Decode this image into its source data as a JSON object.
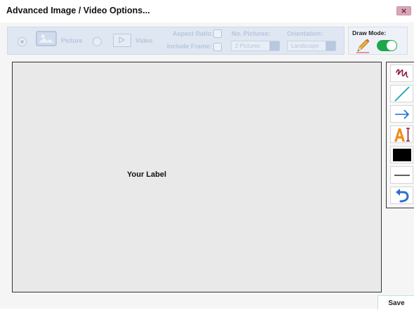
{
  "dialog": {
    "title": "Advanced Image / Video Options...",
    "close_icon": "close-x-icon"
  },
  "options": {
    "picture_label": "Picture",
    "video_label": "Video",
    "picture_selected": true,
    "aspect_ratio_label": "Aspect Ratio:",
    "include_frame_label": "Include Frame:",
    "aspect_ratio_checked": false,
    "include_frame_checked": false,
    "no_pictures_label": "No. Pictures:",
    "no_pictures_value": "2 Pictures",
    "orientation_label": "Orientation:",
    "orientation_value": "Landscape",
    "disabled_color": "#b8c6dc"
  },
  "draw_mode": {
    "label": "Draw Mode:",
    "enabled": true,
    "toggle_color": "#1aa84a",
    "icon": "pencil-icon"
  },
  "canvas": {
    "label": "Your Label",
    "background": "#e9e9e9"
  },
  "tools": [
    {
      "name": "freehand-tool",
      "icon": "scribble-icon",
      "color": "#8b1e3f"
    },
    {
      "name": "line-tool",
      "icon": "line-icon",
      "color": "#1aa5b6"
    },
    {
      "name": "arrow-tool",
      "icon": "arrow-right-icon",
      "color": "#1a6fd4"
    },
    {
      "name": "text-tool",
      "icon": "text-icon",
      "color": "#f08c1a"
    },
    {
      "name": "color-tool",
      "icon": "color-swatch-icon",
      "color": "#000000"
    },
    {
      "name": "stroke-width-tool",
      "icon": "stroke-width-icon",
      "color": "#000000"
    },
    {
      "name": "undo-tool",
      "icon": "undo-icon",
      "color": "#2b6fcf"
    }
  ],
  "footer": {
    "save_label": "Save"
  }
}
